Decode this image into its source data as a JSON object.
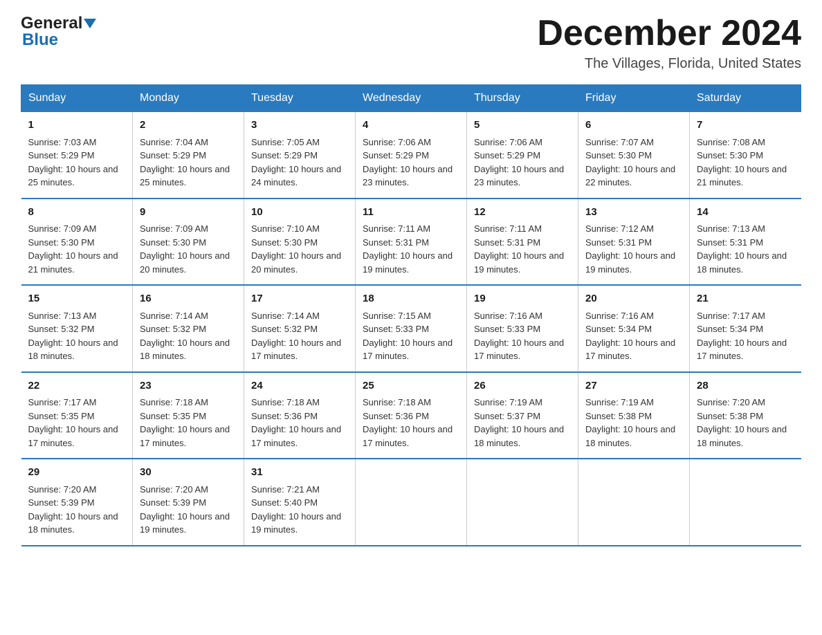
{
  "header": {
    "logo_general": "General",
    "logo_blue": "Blue",
    "month_title": "December 2024",
    "location": "The Villages, Florida, United States"
  },
  "days_of_week": [
    "Sunday",
    "Monday",
    "Tuesday",
    "Wednesday",
    "Thursday",
    "Friday",
    "Saturday"
  ],
  "weeks": [
    [
      {
        "day": "1",
        "sunrise": "7:03 AM",
        "sunset": "5:29 PM",
        "daylight": "10 hours and 25 minutes."
      },
      {
        "day": "2",
        "sunrise": "7:04 AM",
        "sunset": "5:29 PM",
        "daylight": "10 hours and 25 minutes."
      },
      {
        "day": "3",
        "sunrise": "7:05 AM",
        "sunset": "5:29 PM",
        "daylight": "10 hours and 24 minutes."
      },
      {
        "day": "4",
        "sunrise": "7:06 AM",
        "sunset": "5:29 PM",
        "daylight": "10 hours and 23 minutes."
      },
      {
        "day": "5",
        "sunrise": "7:06 AM",
        "sunset": "5:29 PM",
        "daylight": "10 hours and 23 minutes."
      },
      {
        "day": "6",
        "sunrise": "7:07 AM",
        "sunset": "5:30 PM",
        "daylight": "10 hours and 22 minutes."
      },
      {
        "day": "7",
        "sunrise": "7:08 AM",
        "sunset": "5:30 PM",
        "daylight": "10 hours and 21 minutes."
      }
    ],
    [
      {
        "day": "8",
        "sunrise": "7:09 AM",
        "sunset": "5:30 PM",
        "daylight": "10 hours and 21 minutes."
      },
      {
        "day": "9",
        "sunrise": "7:09 AM",
        "sunset": "5:30 PM",
        "daylight": "10 hours and 20 minutes."
      },
      {
        "day": "10",
        "sunrise": "7:10 AM",
        "sunset": "5:30 PM",
        "daylight": "10 hours and 20 minutes."
      },
      {
        "day": "11",
        "sunrise": "7:11 AM",
        "sunset": "5:31 PM",
        "daylight": "10 hours and 19 minutes."
      },
      {
        "day": "12",
        "sunrise": "7:11 AM",
        "sunset": "5:31 PM",
        "daylight": "10 hours and 19 minutes."
      },
      {
        "day": "13",
        "sunrise": "7:12 AM",
        "sunset": "5:31 PM",
        "daylight": "10 hours and 19 minutes."
      },
      {
        "day": "14",
        "sunrise": "7:13 AM",
        "sunset": "5:31 PM",
        "daylight": "10 hours and 18 minutes."
      }
    ],
    [
      {
        "day": "15",
        "sunrise": "7:13 AM",
        "sunset": "5:32 PM",
        "daylight": "10 hours and 18 minutes."
      },
      {
        "day": "16",
        "sunrise": "7:14 AM",
        "sunset": "5:32 PM",
        "daylight": "10 hours and 18 minutes."
      },
      {
        "day": "17",
        "sunrise": "7:14 AM",
        "sunset": "5:32 PM",
        "daylight": "10 hours and 17 minutes."
      },
      {
        "day": "18",
        "sunrise": "7:15 AM",
        "sunset": "5:33 PM",
        "daylight": "10 hours and 17 minutes."
      },
      {
        "day": "19",
        "sunrise": "7:16 AM",
        "sunset": "5:33 PM",
        "daylight": "10 hours and 17 minutes."
      },
      {
        "day": "20",
        "sunrise": "7:16 AM",
        "sunset": "5:34 PM",
        "daylight": "10 hours and 17 minutes."
      },
      {
        "day": "21",
        "sunrise": "7:17 AM",
        "sunset": "5:34 PM",
        "daylight": "10 hours and 17 minutes."
      }
    ],
    [
      {
        "day": "22",
        "sunrise": "7:17 AM",
        "sunset": "5:35 PM",
        "daylight": "10 hours and 17 minutes."
      },
      {
        "day": "23",
        "sunrise": "7:18 AM",
        "sunset": "5:35 PM",
        "daylight": "10 hours and 17 minutes."
      },
      {
        "day": "24",
        "sunrise": "7:18 AM",
        "sunset": "5:36 PM",
        "daylight": "10 hours and 17 minutes."
      },
      {
        "day": "25",
        "sunrise": "7:18 AM",
        "sunset": "5:36 PM",
        "daylight": "10 hours and 17 minutes."
      },
      {
        "day": "26",
        "sunrise": "7:19 AM",
        "sunset": "5:37 PM",
        "daylight": "10 hours and 18 minutes."
      },
      {
        "day": "27",
        "sunrise": "7:19 AM",
        "sunset": "5:38 PM",
        "daylight": "10 hours and 18 minutes."
      },
      {
        "day": "28",
        "sunrise": "7:20 AM",
        "sunset": "5:38 PM",
        "daylight": "10 hours and 18 minutes."
      }
    ],
    [
      {
        "day": "29",
        "sunrise": "7:20 AM",
        "sunset": "5:39 PM",
        "daylight": "10 hours and 18 minutes."
      },
      {
        "day": "30",
        "sunrise": "7:20 AM",
        "sunset": "5:39 PM",
        "daylight": "10 hours and 19 minutes."
      },
      {
        "day": "31",
        "sunrise": "7:21 AM",
        "sunset": "5:40 PM",
        "daylight": "10 hours and 19 minutes."
      },
      null,
      null,
      null,
      null
    ]
  ],
  "labels": {
    "sunrise": "Sunrise:",
    "sunset": "Sunset:",
    "daylight": "Daylight:"
  }
}
